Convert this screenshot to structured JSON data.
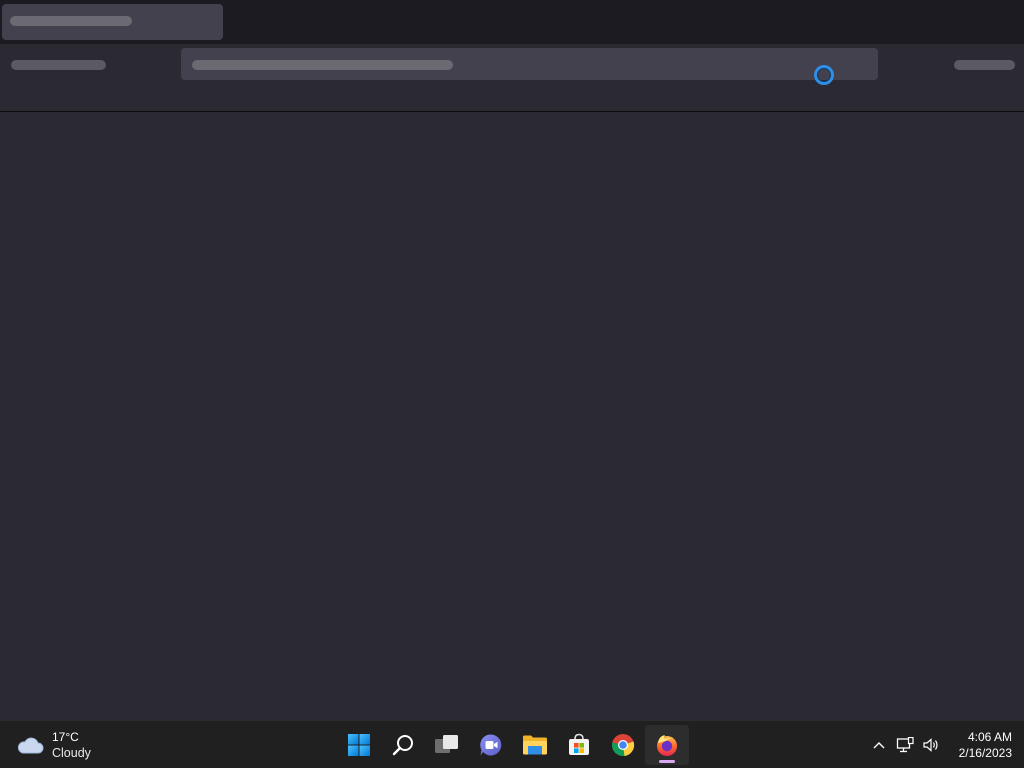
{
  "browser": {
    "state": "loading-skeleton"
  },
  "taskbar": {
    "weather": {
      "temperature": "17°C",
      "condition": "Cloudy",
      "icon": "cloud-icon"
    },
    "apps": [
      {
        "name": "start",
        "icon": "windows-start-icon"
      },
      {
        "name": "search",
        "icon": "search-icon"
      },
      {
        "name": "task-view",
        "icon": "task-view-icon"
      },
      {
        "name": "chat",
        "icon": "teams-chat-icon"
      },
      {
        "name": "file-explorer",
        "icon": "folder-icon"
      },
      {
        "name": "microsoft-store",
        "icon": "store-icon"
      },
      {
        "name": "chrome",
        "icon": "chrome-icon"
      },
      {
        "name": "firefox",
        "icon": "firefox-icon",
        "active": true
      }
    ],
    "tray": {
      "overflow_icon": "chevron-up-icon",
      "network_icon": "network-icon",
      "volume_icon": "volume-icon"
    },
    "clock": {
      "time": "4:06 AM",
      "date": "2/16/2023"
    }
  },
  "colors": {
    "background": "#2b2a33",
    "tabstrip": "#1c1b22",
    "skeleton": "#42414d",
    "taskbar": "#202020",
    "accent": "#2f8ee5"
  }
}
